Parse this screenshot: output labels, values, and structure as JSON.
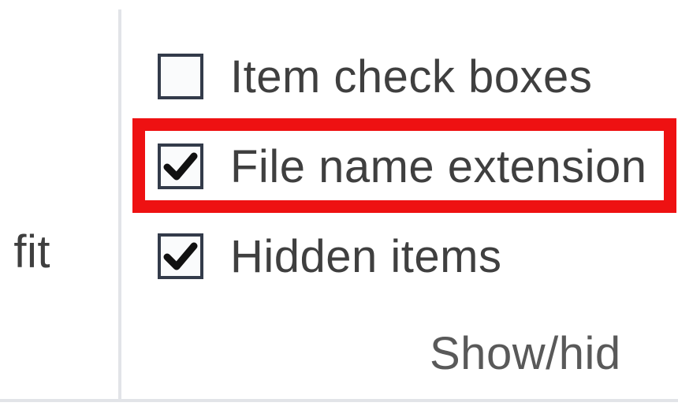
{
  "ribbon": {
    "prev_group_label_fragment": "o fit",
    "show_hide_group": {
      "name_fragment": "Show/hid",
      "options": [
        {
          "label": "Item check boxes",
          "checked": false
        },
        {
          "label": "File name extension",
          "checked": true
        },
        {
          "label": "Hidden items",
          "checked": true
        }
      ],
      "highlighted_option_index": 1
    }
  },
  "annotation": {
    "highlight_color": "#ee1112"
  }
}
